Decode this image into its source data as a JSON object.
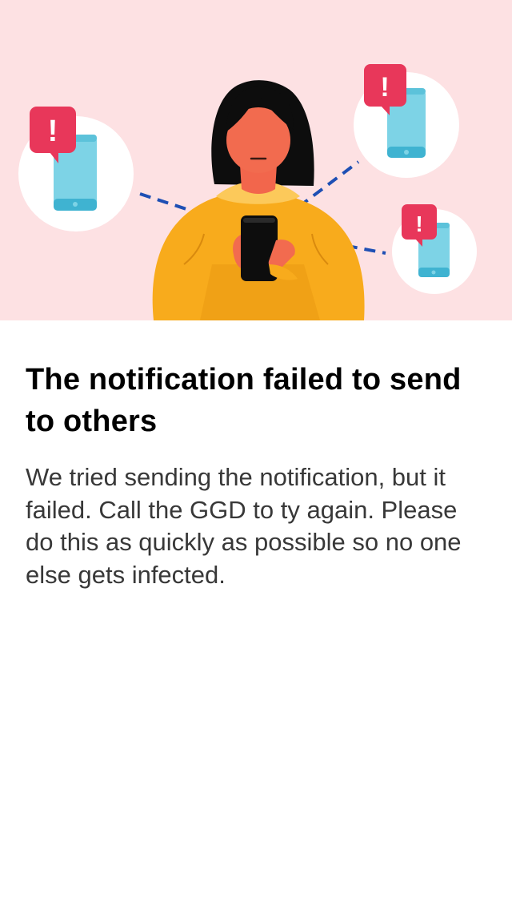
{
  "screen": {
    "title": "The notification failed to send to others",
    "body": "We tried sending the notification, but it failed. Call the GGD to ty again. Please do this as quickly as possible so no one else gets infected."
  },
  "illustration": {
    "subject": "person-holding-phone",
    "alert_glyph": "!",
    "colors": {
      "background": "#fde1e3",
      "sweater": "#f8ab1c",
      "skin": "#f26b4f",
      "hair": "#0d0d0d",
      "alert": "#e8375a",
      "phone": "#7dd3e6",
      "dashed_line": "#1e4fb4"
    }
  }
}
